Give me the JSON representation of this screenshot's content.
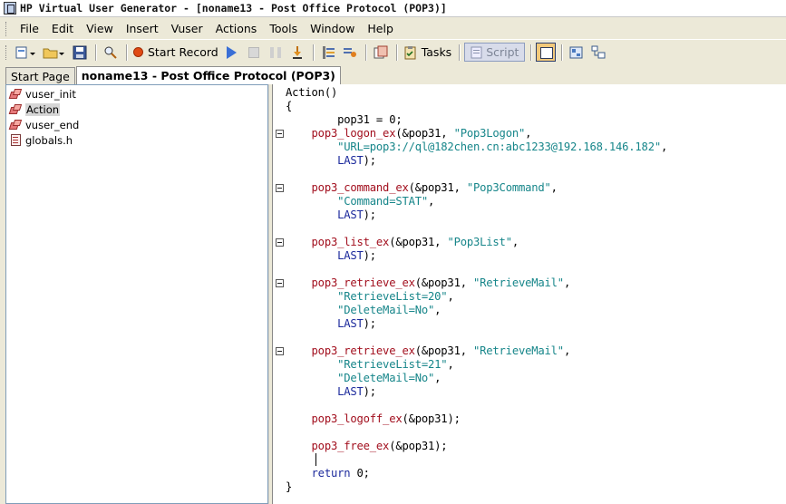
{
  "window": {
    "title": "HP Virtual User Generator - [noname13 - Post Office Protocol (POP3)]"
  },
  "menu": {
    "items": [
      {
        "label": "File"
      },
      {
        "label": "Edit"
      },
      {
        "label": "View"
      },
      {
        "label": "Insert"
      },
      {
        "label": "Vuser"
      },
      {
        "label": "Actions"
      },
      {
        "label": "Tools"
      },
      {
        "label": "Window"
      },
      {
        "label": "Help"
      }
    ]
  },
  "toolbar": {
    "start_record_label": "Start Record",
    "tasks_label": "Tasks",
    "script_label": "Script"
  },
  "tabs": [
    {
      "label": "Start Page",
      "active": false
    },
    {
      "label": "noname13 - Post Office Protocol (POP3)",
      "active": true
    }
  ],
  "tree": {
    "items": [
      {
        "label": "vuser_init",
        "icon": "action-blocks-icon",
        "selected": false
      },
      {
        "label": "Action",
        "icon": "action-blocks-icon",
        "selected": true
      },
      {
        "label": "vuser_end",
        "icon": "action-blocks-icon",
        "selected": false
      },
      {
        "label": "globals.h",
        "icon": "header-file-icon",
        "selected": false
      }
    ]
  },
  "editor": {
    "lines": [
      {
        "fold": false,
        "indent": "",
        "segments": [
          {
            "c": "t-plain",
            "t": "Action()"
          }
        ]
      },
      {
        "fold": false,
        "indent": "",
        "segments": [
          {
            "c": "t-plain",
            "t": "{"
          }
        ]
      },
      {
        "fold": false,
        "indent": "",
        "segments": [
          {
            "c": "t-plain",
            "t": "        pop31 = 0;"
          }
        ]
      },
      {
        "fold": true,
        "indent": "",
        "segments": [
          {
            "c": "t-fn",
            "t": "    pop3_logon_ex"
          },
          {
            "c": "t-plain",
            "t": "(&pop31, "
          },
          {
            "c": "t-str",
            "t": "\"Pop3Logon\""
          },
          {
            "c": "t-plain",
            "t": ","
          }
        ]
      },
      {
        "fold": false,
        "indent": "",
        "segments": [
          {
            "c": "t-str",
            "t": "        \"URL=pop3://ql@182chen.cn:abc1233@192.168.146.182\""
          },
          {
            "c": "t-plain",
            "t": ","
          }
        ]
      },
      {
        "fold": false,
        "indent": "",
        "segments": [
          {
            "c": "t-kw",
            "t": "        LAST"
          },
          {
            "c": "t-plain",
            "t": ");"
          }
        ]
      },
      {
        "fold": false,
        "indent": "",
        "segments": [
          {
            "c": "t-plain",
            "t": ""
          }
        ]
      },
      {
        "fold": true,
        "indent": "",
        "segments": [
          {
            "c": "t-fn",
            "t": "    pop3_command_ex"
          },
          {
            "c": "t-plain",
            "t": "(&pop31, "
          },
          {
            "c": "t-str",
            "t": "\"Pop3Command\""
          },
          {
            "c": "t-plain",
            "t": ","
          }
        ]
      },
      {
        "fold": false,
        "indent": "",
        "segments": [
          {
            "c": "t-str",
            "t": "        \"Command=STAT\""
          },
          {
            "c": "t-plain",
            "t": ","
          }
        ]
      },
      {
        "fold": false,
        "indent": "",
        "segments": [
          {
            "c": "t-kw",
            "t": "        LAST"
          },
          {
            "c": "t-plain",
            "t": ");"
          }
        ]
      },
      {
        "fold": false,
        "indent": "",
        "segments": [
          {
            "c": "t-plain",
            "t": ""
          }
        ]
      },
      {
        "fold": true,
        "indent": "",
        "segments": [
          {
            "c": "t-fn",
            "t": "    pop3_list_ex"
          },
          {
            "c": "t-plain",
            "t": "(&pop31, "
          },
          {
            "c": "t-str",
            "t": "\"Pop3List\""
          },
          {
            "c": "t-plain",
            "t": ","
          }
        ]
      },
      {
        "fold": false,
        "indent": "",
        "segments": [
          {
            "c": "t-kw",
            "t": "        LAST"
          },
          {
            "c": "t-plain",
            "t": ");"
          }
        ]
      },
      {
        "fold": false,
        "indent": "",
        "segments": [
          {
            "c": "t-plain",
            "t": ""
          }
        ]
      },
      {
        "fold": true,
        "indent": "",
        "segments": [
          {
            "c": "t-fn",
            "t": "    pop3_retrieve_ex"
          },
          {
            "c": "t-plain",
            "t": "(&pop31, "
          },
          {
            "c": "t-str",
            "t": "\"RetrieveMail\""
          },
          {
            "c": "t-plain",
            "t": ","
          }
        ]
      },
      {
        "fold": false,
        "indent": "",
        "segments": [
          {
            "c": "t-str",
            "t": "        \"RetrieveList=20\""
          },
          {
            "c": "t-plain",
            "t": ","
          }
        ]
      },
      {
        "fold": false,
        "indent": "",
        "segments": [
          {
            "c": "t-str",
            "t": "        \"DeleteMail=No\""
          },
          {
            "c": "t-plain",
            "t": ","
          }
        ]
      },
      {
        "fold": false,
        "indent": "",
        "segments": [
          {
            "c": "t-kw",
            "t": "        LAST"
          },
          {
            "c": "t-plain",
            "t": ");"
          }
        ]
      },
      {
        "fold": false,
        "indent": "",
        "segments": [
          {
            "c": "t-plain",
            "t": ""
          }
        ]
      },
      {
        "fold": true,
        "indent": "",
        "segments": [
          {
            "c": "t-fn",
            "t": "    pop3_retrieve_ex"
          },
          {
            "c": "t-plain",
            "t": "(&pop31, "
          },
          {
            "c": "t-str",
            "t": "\"RetrieveMail\""
          },
          {
            "c": "t-plain",
            "t": ","
          }
        ]
      },
      {
        "fold": false,
        "indent": "",
        "segments": [
          {
            "c": "t-str",
            "t": "        \"RetrieveList=21\""
          },
          {
            "c": "t-plain",
            "t": ","
          }
        ]
      },
      {
        "fold": false,
        "indent": "",
        "segments": [
          {
            "c": "t-str",
            "t": "        \"DeleteMail=No\""
          },
          {
            "c": "t-plain",
            "t": ","
          }
        ]
      },
      {
        "fold": false,
        "indent": "",
        "segments": [
          {
            "c": "t-kw",
            "t": "        LAST"
          },
          {
            "c": "t-plain",
            "t": ");"
          }
        ]
      },
      {
        "fold": false,
        "indent": "",
        "segments": [
          {
            "c": "t-plain",
            "t": ""
          }
        ]
      },
      {
        "fold": false,
        "indent": "",
        "segments": [
          {
            "c": "t-fn",
            "t": "    pop3_logoff_ex"
          },
          {
            "c": "t-plain",
            "t": "(&pop31);"
          }
        ]
      },
      {
        "fold": false,
        "indent": "",
        "segments": [
          {
            "c": "t-plain",
            "t": ""
          }
        ]
      },
      {
        "fold": false,
        "indent": "",
        "segments": [
          {
            "c": "t-fn",
            "t": "    pop3_free_ex"
          },
          {
            "c": "t-plain",
            "t": "(&pop31);"
          }
        ]
      },
      {
        "fold": false,
        "indent": "",
        "segments": [
          {
            "c": "t-plain",
            "t": ""
          }
        ]
      },
      {
        "fold": false,
        "indent": "",
        "segments": [
          {
            "c": "t-kw",
            "t": "    return"
          },
          {
            "c": "t-plain",
            "t": " 0;"
          }
        ]
      },
      {
        "fold": false,
        "indent": "",
        "segments": [
          {
            "c": "t-plain",
            "t": "}"
          }
        ]
      }
    ]
  }
}
